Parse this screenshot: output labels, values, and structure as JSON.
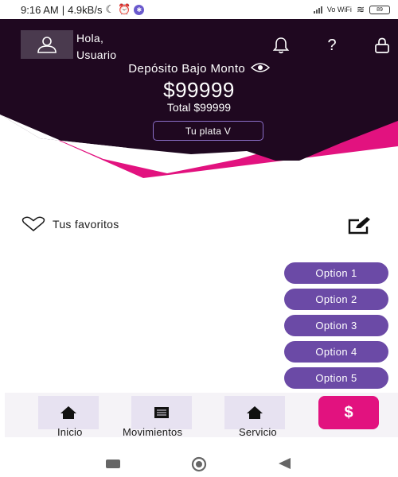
{
  "status_bar": {
    "time": "9:16 AM",
    "net_speed": "4.9kB/s",
    "sim_label": "Vo WiFi",
    "battery": "89"
  },
  "header": {
    "greeting_line1": "Hola,",
    "greeting_line2": "Usuario",
    "deposit_label": "Depósito Bajo Monto",
    "amount": "$99999",
    "total": "Total $99999",
    "plata_button": "Tu plata V",
    "colors": {
      "background": "#1f0820",
      "accent": "#e2127f"
    }
  },
  "favorites": {
    "label": "Tus favoritos"
  },
  "options": [
    {
      "label": "Option 1"
    },
    {
      "label": "Option 2"
    },
    {
      "label": "Option 3"
    },
    {
      "label": "Option 4"
    },
    {
      "label": "Option 5"
    }
  ],
  "bottom_nav": {
    "items": [
      {
        "label": "Inicio",
        "icon": "home-icon"
      },
      {
        "label": "Movimientos",
        "icon": "list-icon"
      },
      {
        "label": "Servicio",
        "icon": "home-icon"
      }
    ],
    "pay_button": "$"
  },
  "icons": {
    "avatar": "user-icon",
    "notifications": "bell-icon",
    "help": "question-icon",
    "lock": "lock-icon",
    "visibility": "eye-icon",
    "favorites": "heart-icon",
    "edit": "edit-icon"
  }
}
